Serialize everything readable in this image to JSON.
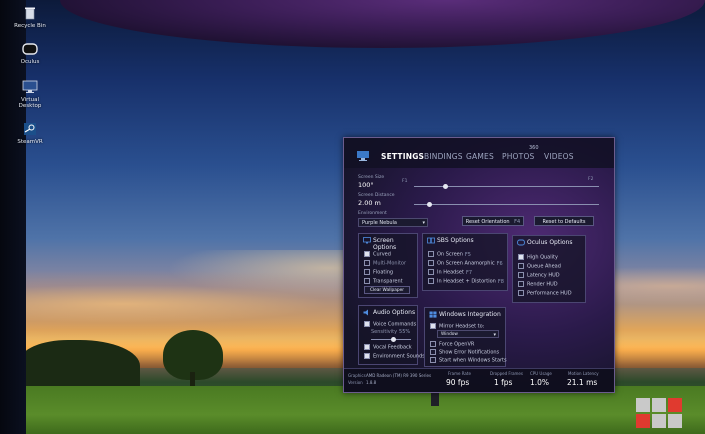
{
  "desktop": {
    "icons": [
      {
        "label": "Recycle Bin",
        "icon": "recycle-bin-icon"
      },
      {
        "label": "Oculus",
        "icon": "oculus-icon"
      },
      {
        "label": "Virtual Desktop",
        "icon": "virtual-desktop-icon"
      },
      {
        "label": "SteamVR",
        "icon": "steamvr-icon"
      }
    ]
  },
  "panel": {
    "tabs": [
      {
        "label": "SETTINGS",
        "active": true
      },
      {
        "label": "BINDINGS",
        "active": false
      },
      {
        "label": "GAMES",
        "active": false
      },
      {
        "label": "PHOTOS",
        "active": false
      },
      {
        "label": "VIDEOS",
        "active": false
      }
    ],
    "photos_badge": "360",
    "screen_size": {
      "label": "Screen Size",
      "value": "100°",
      "hint_left": "F1",
      "hint_right": "F2"
    },
    "screen_distance": {
      "label": "Screen Distance",
      "value": "2.00 m"
    },
    "environment": {
      "label": "Environment",
      "selected": "Purple Nebula"
    },
    "reset_orientation": {
      "label": "Reset Orientation",
      "key": "F4"
    },
    "reset_defaults": {
      "label": "Reset to Defaults"
    },
    "screen_options": {
      "title": "Screen Options",
      "items": [
        {
          "label": "Curved",
          "checked": true,
          "dim": false
        },
        {
          "label": "Multi-Monitor",
          "checked": false,
          "dim": true
        },
        {
          "label": "Floating",
          "checked": false,
          "dim": false
        },
        {
          "label": "Transparent",
          "checked": false,
          "dim": false
        }
      ],
      "button": "Clear Wallpaper"
    },
    "sbs_options": {
      "title": "SBS Options",
      "items": [
        {
          "label": "On Screen",
          "key": "F5",
          "checked": false
        },
        {
          "label": "On Screen Anamorphic",
          "key": "F6",
          "checked": false
        },
        {
          "label": "In Headset",
          "key": "F7",
          "checked": false
        },
        {
          "label": "In Headset + Distortion",
          "key": "F8",
          "checked": false
        }
      ]
    },
    "oculus_options": {
      "title": "Oculus Options",
      "items": [
        {
          "label": "High Quality",
          "checked": true
        },
        {
          "label": "Queue Ahead",
          "checked": false
        },
        {
          "label": "Latency HUD",
          "checked": false
        },
        {
          "label": "Render HUD",
          "checked": false
        },
        {
          "label": "Performance HUD",
          "checked": false
        }
      ]
    },
    "audio_options": {
      "title": "Audio Options",
      "items": [
        {
          "label": "Voice Commands",
          "checked": true
        },
        {
          "label": "Sensitivity",
          "extra": "55%",
          "checked": false,
          "dim": true
        },
        {
          "label": "Vocal Feedback",
          "checked": true
        },
        {
          "label": "Environment Sounds",
          "checked": true
        }
      ],
      "sensitivity_fraction": 0.55
    },
    "windows_integration": {
      "title": "Windows Integration",
      "items": [
        {
          "label": "Mirror Headset to:",
          "checked": true
        },
        {
          "label": "Force OpenVR",
          "checked": false
        },
        {
          "label": "Show Error Notifications",
          "checked": false
        },
        {
          "label": "Start when Windows Starts",
          "checked": false
        }
      ],
      "mirror_target": "Window"
    },
    "status": {
      "gpu_label": "Graphics",
      "gpu_value": "AMD Radeon (TM) R9 390 Series",
      "version_label": "Version",
      "version_value": "1.8.8",
      "metrics": [
        {
          "label": "Frame Rate",
          "value": "90 fps"
        },
        {
          "label": "Dropped Frames",
          "value": "1 fps"
        },
        {
          "label": "CPU Usage",
          "value": "1.0%"
        },
        {
          "label": "Motion Latency",
          "value": "21.1 ms"
        }
      ]
    }
  },
  "colors": {
    "panel_bg": "#2a1a4a",
    "accent": "#4b4672",
    "watermark_red": "#e03a2f",
    "watermark_gray": "#c9c9c9"
  }
}
